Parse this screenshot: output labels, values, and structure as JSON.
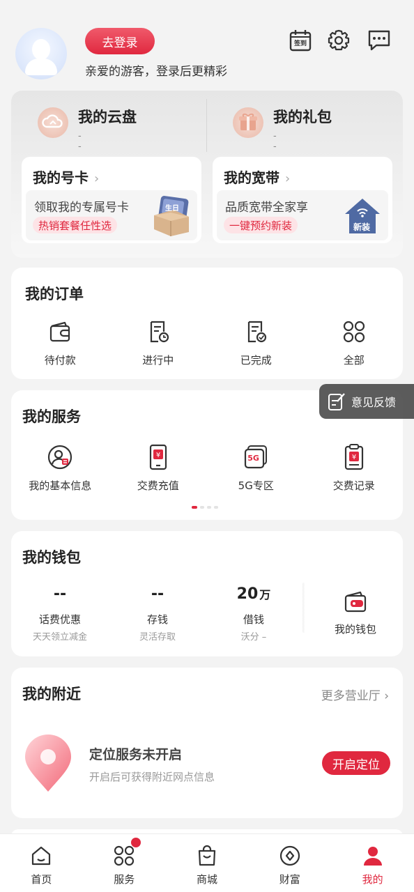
{
  "header": {
    "login_button": "去登录",
    "greeting": "亲爱的游客，登录后更精彩",
    "checkin_label": "签到",
    "icons": [
      "calendar-checkin-icon",
      "gear-icon",
      "message-icon"
    ]
  },
  "assets": {
    "cloud": {
      "title": "我的云盘",
      "sub": "--"
    },
    "gift": {
      "title": "我的礼包",
      "sub": "--"
    },
    "simcard": {
      "title": "我的号卡",
      "chevron": "›",
      "text": "领取我的专属号卡",
      "tag": "热销套餐任性选",
      "pic_label": "生日"
    },
    "broadband": {
      "title": "我的宽带",
      "chevron": "›",
      "text": "品质宽带全家享",
      "tag": "一键预约新装",
      "pic_label": "新装"
    }
  },
  "orders": {
    "title": "我的订单",
    "items": [
      {
        "label": "待付款",
        "icon": "wallet-icon"
      },
      {
        "label": "进行中",
        "icon": "document-clock-icon"
      },
      {
        "label": "已完成",
        "icon": "document-check-icon"
      },
      {
        "label": "全部",
        "icon": "grid-icon"
      }
    ]
  },
  "services": {
    "title": "我的服务",
    "items": [
      {
        "label": "我的基本信息",
        "icon": "user-info-icon"
      },
      {
        "label": "交费充值",
        "icon": "phone-recharge-icon"
      },
      {
        "label": "5G专区",
        "icon": "5g-icon",
        "badge": "5G"
      },
      {
        "label": "交费记录",
        "icon": "payment-record-icon"
      }
    ],
    "page_count": 4,
    "active_page": 0
  },
  "feedback": {
    "label": "意见反馈"
  },
  "wallet": {
    "title": "我的钱包",
    "items": [
      {
        "value": "--",
        "unit": "",
        "label": "话费优惠",
        "sub": "天天领立减金"
      },
      {
        "value": "--",
        "unit": "",
        "label": "存钱",
        "sub": "灵活存取"
      },
      {
        "value": "20",
        "unit": "万",
        "label": "借钱",
        "sub": "沃分 –"
      }
    ],
    "my_wallet": "我的钱包"
  },
  "nearby": {
    "title": "我的附近",
    "more": "更多营业厅 ›",
    "loc_title": "定位服务未开启",
    "loc_sub": "开启后可获得附近网点信息",
    "loc_button": "开启定位"
  },
  "tabbar": {
    "items": [
      {
        "label": "首页",
        "icon": "home-icon"
      },
      {
        "label": "服务",
        "icon": "services-grid-icon"
      },
      {
        "label": "商城",
        "icon": "shopping-bag-icon"
      },
      {
        "label": "财富",
        "icon": "wealth-icon"
      },
      {
        "label": "我的",
        "icon": "profile-icon"
      }
    ],
    "active": "我的"
  },
  "colors": {
    "accent": "#e0283f",
    "background": "#f3f3f3"
  }
}
